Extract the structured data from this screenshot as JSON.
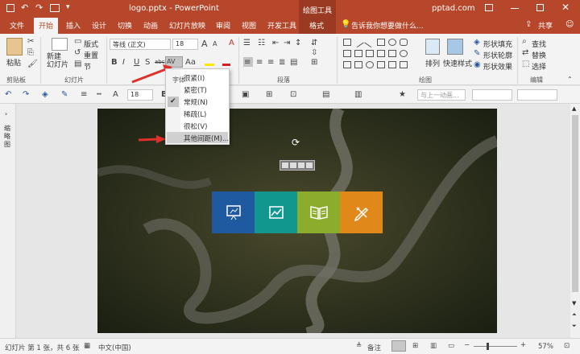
{
  "titlebar": {
    "doc_title": "logo.pptx  -  PowerPoint",
    "context_tools": "绘图工具",
    "account": "pptad.com"
  },
  "tabs": [
    "文件",
    "开始",
    "插入",
    "设计",
    "切换",
    "动画",
    "幻灯片放映",
    "审阅",
    "视图",
    "开发工具",
    "格式"
  ],
  "tell_me": "告诉我你想要做什么...",
  "share": "共享",
  "ribbon": {
    "clipboard": {
      "paste": "粘贴",
      "label": "剪贴板"
    },
    "slides": {
      "new_slide": "新建\n幻灯片",
      "layout": "版式",
      "reset": "重置",
      "section": "节",
      "label": "幻灯片"
    },
    "font": {
      "font_name": "等线 (正文)",
      "font_size": "18",
      "bold": "B",
      "italic": "I",
      "underline": "U",
      "shadow": "S",
      "strike": "abc",
      "spacing": "AV",
      "case": "Aa",
      "clear": "A",
      "grow": "A",
      "shrink": "A",
      "label": "字体"
    },
    "paragraph": {
      "label": "段落"
    },
    "drawing": {
      "arrange": "排列",
      "quick_styles": "快速样式",
      "fill": "形状填充",
      "outline": "形状轮廓",
      "effects": "形状效果",
      "label": "绘图"
    },
    "editing": {
      "find": "查找",
      "replace": "替换",
      "select": "选择",
      "label": "编辑"
    }
  },
  "toolbar2": {
    "font_size": "18",
    "animation": "与上一动画..."
  },
  "left_pane": "缩略图",
  "spacing_menu": {
    "items": [
      "很紧(I)",
      "紧密(T)",
      "常规(N)",
      "稀疏(L)",
      "很松(V)",
      "其他间距(M)..."
    ],
    "checked_index": 2
  },
  "status": {
    "slide_info": "幻灯片 第 1 张，共 6 张",
    "language": "中文(中国)",
    "notes": "备注",
    "zoom": "57%"
  },
  "colors": {
    "accent": "#b7472a",
    "tile1": "#1f5aa0",
    "tile2": "#12978f",
    "tile3": "#8cad2b",
    "tile4": "#e0881a",
    "arrow": "#e0302a"
  }
}
